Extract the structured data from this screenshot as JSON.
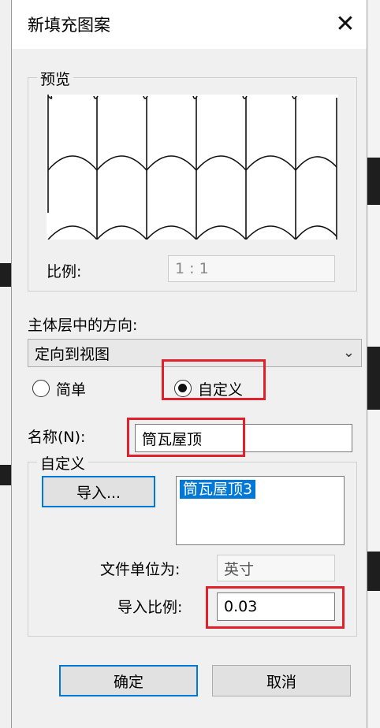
{
  "dialog": {
    "title": "新填充图案",
    "close_glyph": "✕"
  },
  "preview": {
    "group_label": "预览",
    "scale_label": "比例:",
    "scale_value": "1 : 1"
  },
  "orientation": {
    "label": "主体层中的方向:",
    "selected": "定向到视图",
    "chevron": "⌄"
  },
  "type": {
    "options": [
      {
        "label": "简单",
        "selected": false
      },
      {
        "label": "自定义",
        "selected": true
      }
    ]
  },
  "name": {
    "label": "名称(N):",
    "value": "筒瓦屋顶"
  },
  "custom": {
    "group_label": "自定义",
    "import_button": "导入...",
    "list_items": [
      "筒瓦屋顶3"
    ],
    "file_unit_label": "文件单位为:",
    "file_unit_value": "英寸",
    "import_scale_label": "导入比例:",
    "import_scale_value": "0.03"
  },
  "footer": {
    "ok_button": "确定",
    "cancel_button": "取消"
  },
  "highlight_color": "#e0202a",
  "accent_color": "#0078d7"
}
